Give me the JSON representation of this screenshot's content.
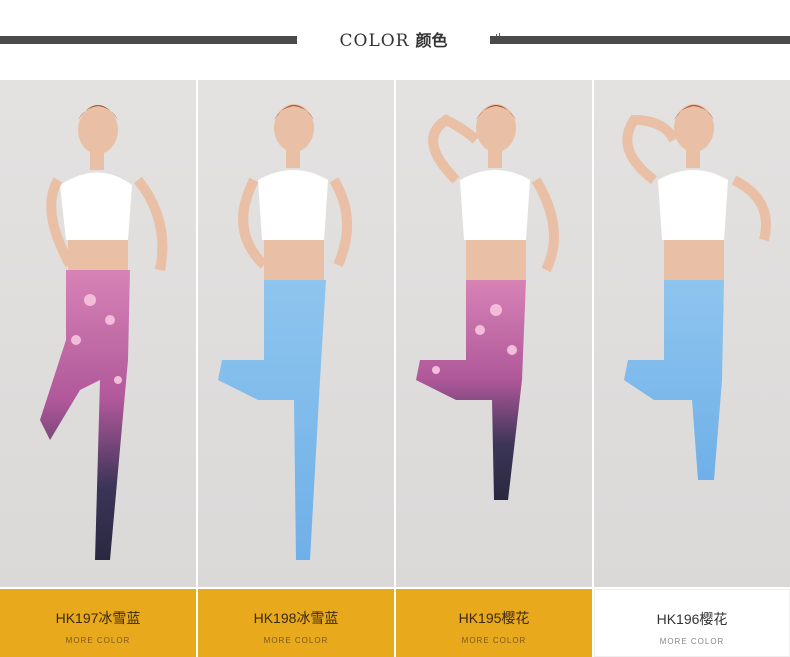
{
  "header": {
    "title_en": "COLOR",
    "title_cn": "颜色",
    "bar_color": "#4a4a4a"
  },
  "products": [
    {
      "code": "HK197冰雪蓝",
      "sub": "MORE COLOR",
      "legging_color": "pink-floral-on-navy",
      "label_bg": "#e9a91c"
    },
    {
      "code": "HK198冰雪蓝",
      "sub": "MORE COLOR",
      "legging_color": "light-blue-snowflake",
      "label_bg": "#e9a91c"
    },
    {
      "code": "HK195樱花",
      "sub": "MORE COLOR",
      "legging_color": "pink-floral-on-navy",
      "label_bg": "#e9a91c"
    },
    {
      "code": "HK196樱花",
      "sub": "MORE COLOR",
      "legging_color": "light-blue-snowflake",
      "label_bg": "#ffffff"
    }
  ]
}
